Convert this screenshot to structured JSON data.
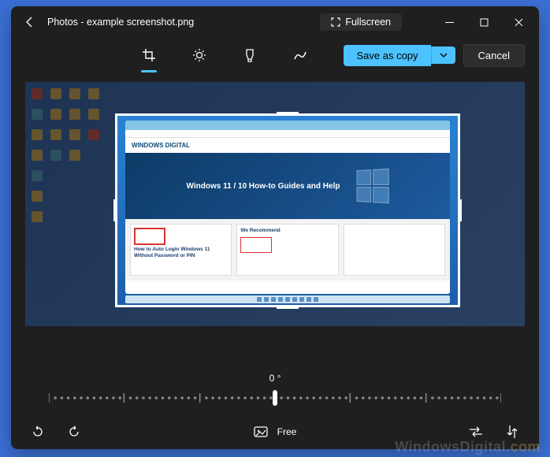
{
  "titlebar": {
    "app": "Photos",
    "filename": "example screenshot.png",
    "fullscreen": "Fullscreen"
  },
  "toolbar": {
    "save_label": "Save as copy",
    "cancel_label": "Cancel"
  },
  "rotation": {
    "degrees": "0 °"
  },
  "bottombar": {
    "aspect_label": "Free"
  },
  "cropped": {
    "logo": "WINDOWS DIGITAL",
    "hero": "Windows 11 / 10 How-to Guides and Help",
    "card1_title": "How to Auto Login Windows 11 Without Password or PIN",
    "card2_title": "We Recommend"
  },
  "watermark": {
    "brand": "WindowsDigital",
    "tld": ".com"
  }
}
